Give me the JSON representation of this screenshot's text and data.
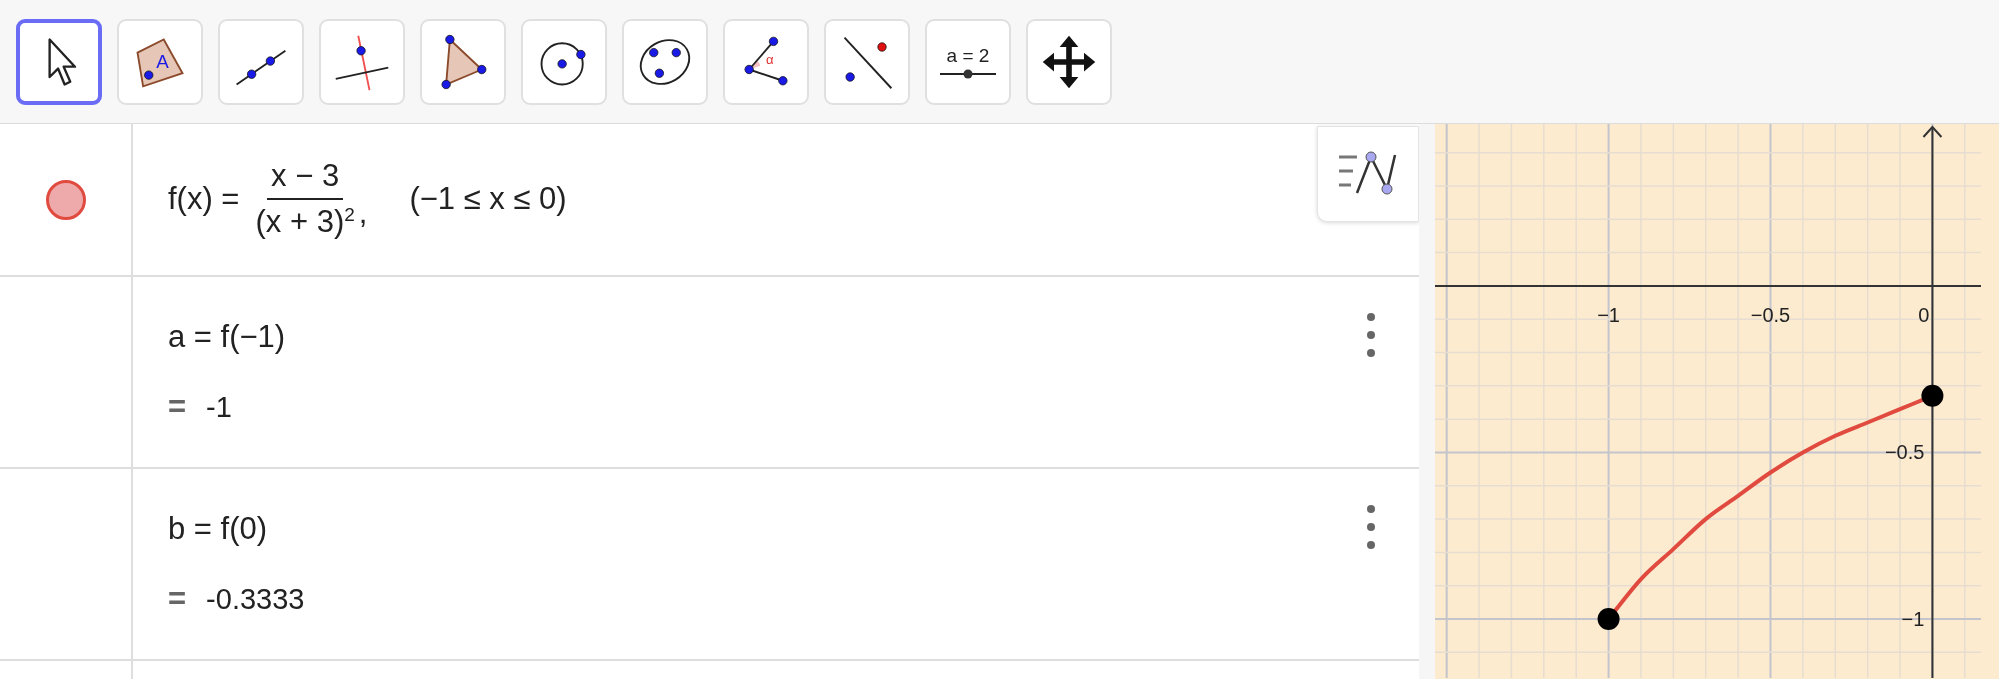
{
  "toolbar": {
    "tools": [
      {
        "kind": "pointer",
        "selected": true
      },
      {
        "kind": "polygon",
        "selected": false,
        "label": "A"
      },
      {
        "kind": "line",
        "selected": false
      },
      {
        "kind": "perpendicular",
        "selected": false
      },
      {
        "kind": "triangle",
        "selected": false
      },
      {
        "kind": "circle",
        "selected": false
      },
      {
        "kind": "conic",
        "selected": false
      },
      {
        "kind": "angle",
        "selected": false,
        "label": "α"
      },
      {
        "kind": "parallel",
        "selected": false
      },
      {
        "kind": "slider",
        "selected": false,
        "label": "a = 2"
      },
      {
        "kind": "move",
        "selected": false
      }
    ]
  },
  "algebra": {
    "rows": [
      {
        "kind": "function",
        "color": "#e04a3f",
        "visible": true,
        "lhs": "f(x) =",
        "numerator": "x − 3",
        "denominator": "(x + 3)$^{2}$",
        "separator": ",",
        "condition": "(−1 ≤ x ≤ 0)"
      },
      {
        "kind": "value",
        "input": "a = f(−1)",
        "equals": "=",
        "output": "-1"
      },
      {
        "kind": "value",
        "input": "b = f(0)",
        "equals": "=",
        "output": "-0.3333"
      }
    ]
  },
  "graphics": {
    "chart_data": {
      "type": "line",
      "x": [
        -1,
        -0.9,
        -0.8,
        -0.7,
        -0.6,
        -0.5,
        -0.4,
        -0.3,
        -0.2,
        -0.1,
        0
      ],
      "series": [
        {
          "color": "#e04a3f",
          "values": [
            -1,
            -0.88,
            -0.79,
            -0.7,
            -0.63,
            -0.56,
            -0.5,
            -0.45,
            -0.41,
            -0.37,
            -0.33
          ]
        }
      ],
      "grid": true,
      "xlim": [
        -1.536,
        0.15
      ],
      "ylim": [
        -1.177,
        0.486
      ],
      "xticks": [
        {
          "value": -1,
          "label": "−1"
        },
        {
          "value": -0.5,
          "label": "−0.5"
        },
        {
          "value": 0,
          "label": "0"
        }
      ],
      "yticks": [
        {
          "value": -0.5,
          "label": "−0.5"
        },
        {
          "value": -1,
          "label": "−1"
        }
      ]
    }
  }
}
